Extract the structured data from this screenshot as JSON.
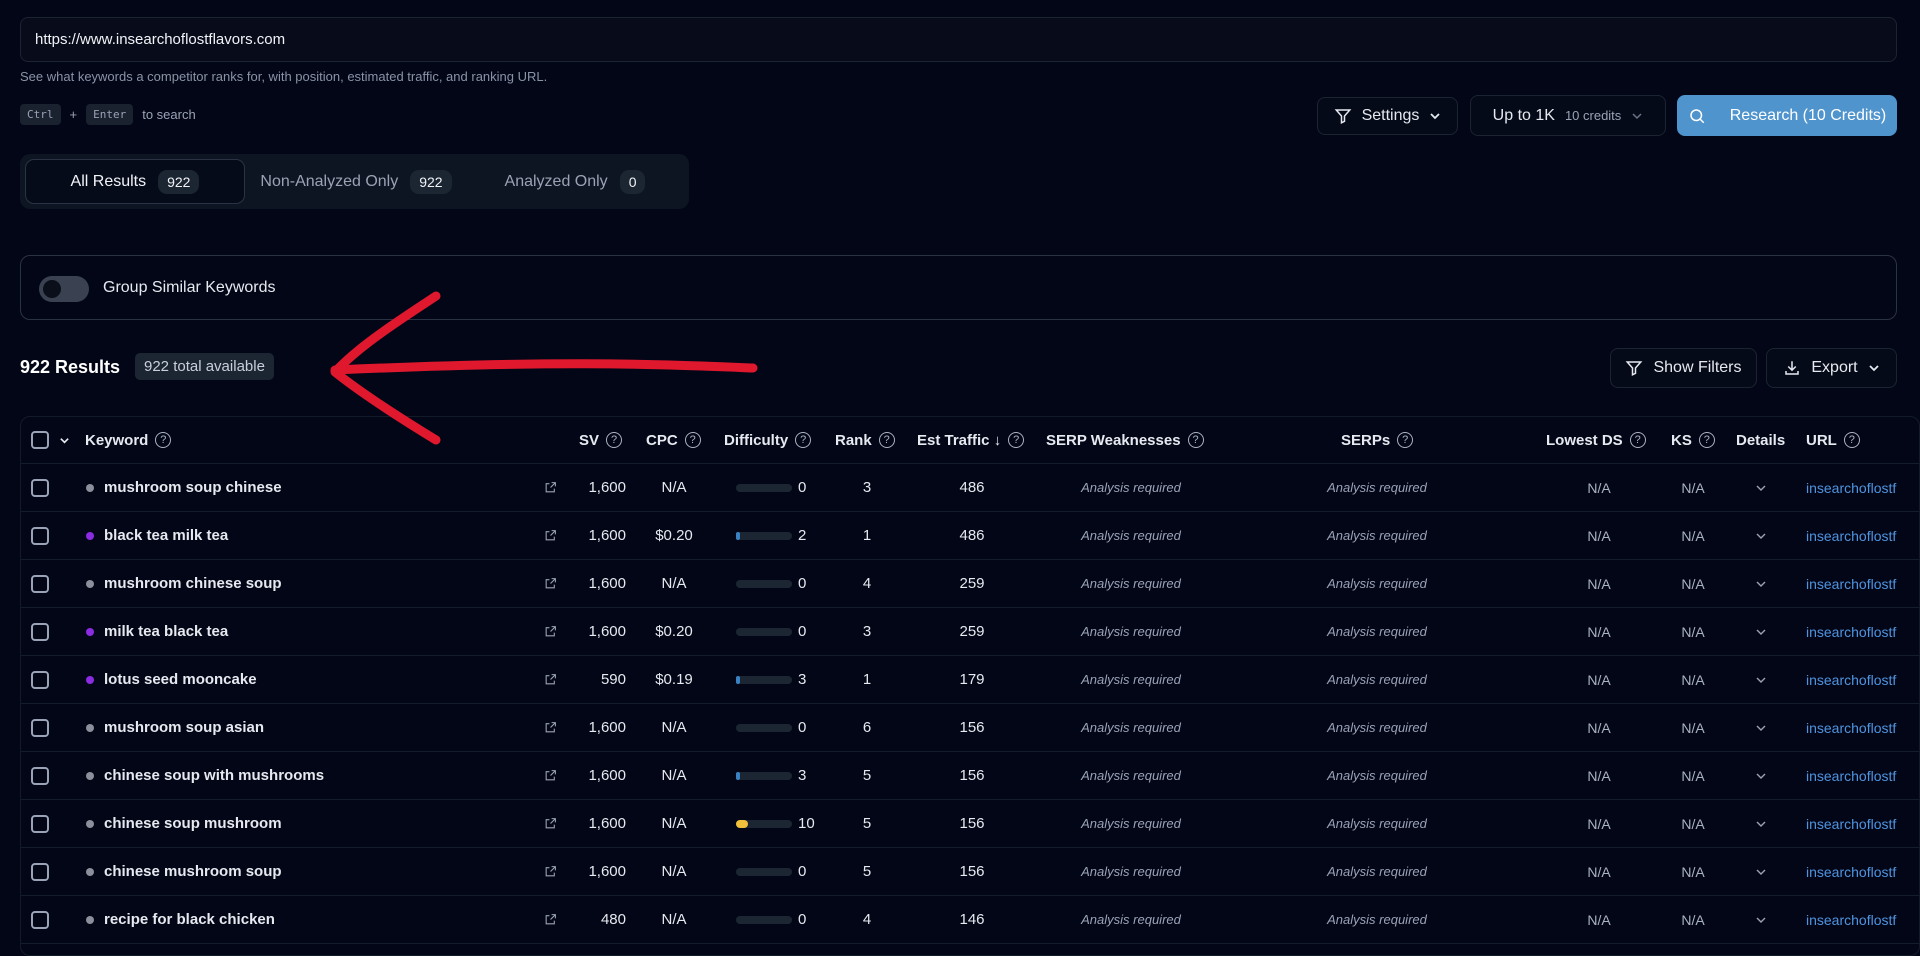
{
  "search": {
    "url_value": "https://www.insearchoflostflavors.com",
    "hint": "See what keywords a competitor ranks for, with position, estimated traffic, and ranking URL.",
    "kbd_ctrl": "Ctrl",
    "kbd_plus": "+",
    "kbd_enter": "Enter",
    "kbd_suffix": "to search"
  },
  "toolbar": {
    "settings_label": "Settings",
    "limit_label": "Up to 1K",
    "limit_credits": "10 credits",
    "research_label": "Research (10 Credits)"
  },
  "tabs": [
    {
      "label": "All Results",
      "count": "922"
    },
    {
      "label": "Non-Analyzed Only",
      "count": "922"
    },
    {
      "label": "Analyzed Only",
      "count": "0"
    }
  ],
  "group": {
    "label": "Group Similar Keywords",
    "enabled": false
  },
  "results": {
    "title": "922 Results",
    "badge": "922 total available",
    "show_filters": "Show Filters",
    "export": "Export"
  },
  "table": {
    "headers": {
      "keyword": "Keyword",
      "sv": "SV",
      "cpc": "CPC",
      "difficulty": "Difficulty",
      "rank": "Rank",
      "est_traffic": "Est Traffic ↓",
      "serp_weak": "SERP Weaknesses",
      "serps": "SERPs",
      "lowest_ds": "Lowest DS",
      "ks": "KS",
      "details": "Details",
      "url": "URL"
    },
    "rows": [
      {
        "keyword": "mushroom soup chinese",
        "dot": "#8a8f9c",
        "sv": "1,600",
        "cpc": "N/A",
        "difficulty": "0",
        "rank": "3",
        "traffic": "486",
        "serp_weak": "Analysis required",
        "serps": "Analysis required",
        "lowest_ds": "N/A",
        "ks": "N/A",
        "url": "insearchoflostf"
      },
      {
        "keyword": "black tea milk tea",
        "dot": "#8b2be2",
        "sv": "1,600",
        "cpc": "$0.20",
        "difficulty": "2",
        "rank": "1",
        "traffic": "486",
        "serp_weak": "Analysis required",
        "serps": "Analysis required",
        "lowest_ds": "N/A",
        "ks": "N/A",
        "url": "insearchoflostf"
      },
      {
        "keyword": "mushroom chinese soup",
        "dot": "#8a8f9c",
        "sv": "1,600",
        "cpc": "N/A",
        "difficulty": "0",
        "rank": "4",
        "traffic": "259",
        "serp_weak": "Analysis required",
        "serps": "Analysis required",
        "lowest_ds": "N/A",
        "ks": "N/A",
        "url": "insearchoflostf"
      },
      {
        "keyword": "milk tea black tea",
        "dot": "#8b2be2",
        "sv": "1,600",
        "cpc": "$0.20",
        "difficulty": "0",
        "rank": "3",
        "traffic": "259",
        "serp_weak": "Analysis required",
        "serps": "Analysis required",
        "lowest_ds": "N/A",
        "ks": "N/A",
        "url": "insearchoflostf"
      },
      {
        "keyword": "lotus seed mooncake",
        "dot": "#8b2be2",
        "sv": "590",
        "cpc": "$0.19",
        "difficulty": "3",
        "rank": "1",
        "traffic": "179",
        "serp_weak": "Analysis required",
        "serps": "Analysis required",
        "lowest_ds": "N/A",
        "ks": "N/A",
        "url": "insearchoflostf"
      },
      {
        "keyword": "mushroom soup asian",
        "dot": "#8a8f9c",
        "sv": "1,600",
        "cpc": "N/A",
        "difficulty": "0",
        "rank": "6",
        "traffic": "156",
        "serp_weak": "Analysis required",
        "serps": "Analysis required",
        "lowest_ds": "N/A",
        "ks": "N/A",
        "url": "insearchoflostf"
      },
      {
        "keyword": "chinese soup with mushrooms",
        "dot": "#8a8f9c",
        "sv": "1,600",
        "cpc": "N/A",
        "difficulty": "3",
        "rank": "5",
        "traffic": "156",
        "serp_weak": "Analysis required",
        "serps": "Analysis required",
        "lowest_ds": "N/A",
        "ks": "N/A",
        "url": "insearchoflostf"
      },
      {
        "keyword": "chinese soup mushroom",
        "dot": "#8a8f9c",
        "sv": "1,600",
        "cpc": "N/A",
        "difficulty": "10",
        "rank": "5",
        "traffic": "156",
        "serp_weak": "Analysis required",
        "serps": "Analysis required",
        "lowest_ds": "N/A",
        "ks": "N/A",
        "url": "insearchoflostf"
      },
      {
        "keyword": "chinese mushroom soup",
        "dot": "#8a8f9c",
        "sv": "1,600",
        "cpc": "N/A",
        "difficulty": "0",
        "rank": "5",
        "traffic": "156",
        "serp_weak": "Analysis required",
        "serps": "Analysis required",
        "lowest_ds": "N/A",
        "ks": "N/A",
        "url": "insearchoflostf"
      },
      {
        "keyword": "recipe for black chicken",
        "dot": "#8a8f9c",
        "sv": "480",
        "cpc": "N/A",
        "difficulty": "0",
        "rank": "4",
        "traffic": "146",
        "serp_weak": "Analysis required",
        "serps": "Analysis required",
        "lowest_ds": "N/A",
        "ks": "N/A",
        "url": "insearchoflostf"
      }
    ]
  },
  "colors": {
    "accent": "#4f94cd",
    "difficulty_low": "#3b82c4",
    "difficulty_mid": "#f2c13b",
    "annotation": "#e0182d"
  }
}
